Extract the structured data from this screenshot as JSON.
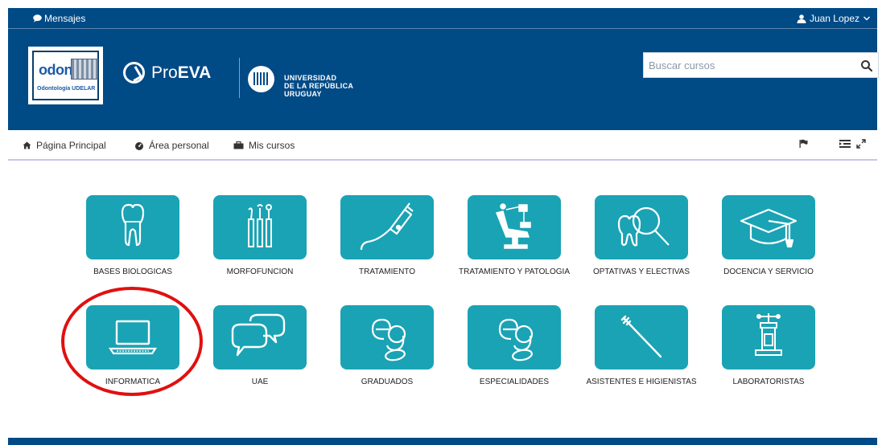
{
  "topbar": {
    "messages_label": "Mensajes",
    "user_name": "Juan Lopez"
  },
  "header": {
    "odon_word": "odon",
    "odon_sub": "Odontología  UDELAR",
    "proeva_pre": "Pro",
    "proeva_bold": "EVA",
    "udelar_line1": "UNIVERSIDAD",
    "udelar_line2": "DE LA REPÚBLICA",
    "udelar_line3": "URUGUAY"
  },
  "search": {
    "placeholder": "Buscar cursos"
  },
  "nav": {
    "home": "Página Principal",
    "personal": "Área personal",
    "courses": "Mis cursos"
  },
  "tiles": [
    {
      "label": "BASES BIOLOGICAS",
      "icon": "tooth-icon"
    },
    {
      "label": "MORFOFUNCION",
      "icon": "dental-tools-icon"
    },
    {
      "label": "TRATAMIENTO",
      "icon": "dental-drill-icon"
    },
    {
      "label": "TRATAMIENTO Y PATOLOGIA",
      "icon": "dental-chair-icon"
    },
    {
      "label": "OPTATIVAS Y ELECTIVAS",
      "icon": "tooth-magnifier-icon"
    },
    {
      "label": "DOCENCIA Y SERVICIO",
      "icon": "graduation-cap-icon"
    },
    {
      "label": "INFORMATICA",
      "icon": "laptop-icon"
    },
    {
      "label": "UAE",
      "icon": "chat-bubbles-icon"
    },
    {
      "label": "GRADUADOS",
      "icon": "eg-logo-icon"
    },
    {
      "label": "ESPECIALIDADES",
      "icon": "eg-logo-icon"
    },
    {
      "label": "ASISTENTES E HIGIENISTAS",
      "icon": "toothbrush-icon"
    },
    {
      "label": "LABORATORISTAS",
      "icon": "lab-press-icon"
    }
  ],
  "colors": {
    "brand_blue": "#004a86",
    "tile_teal": "#1aa3b4",
    "annotation_red": "#e01010"
  }
}
